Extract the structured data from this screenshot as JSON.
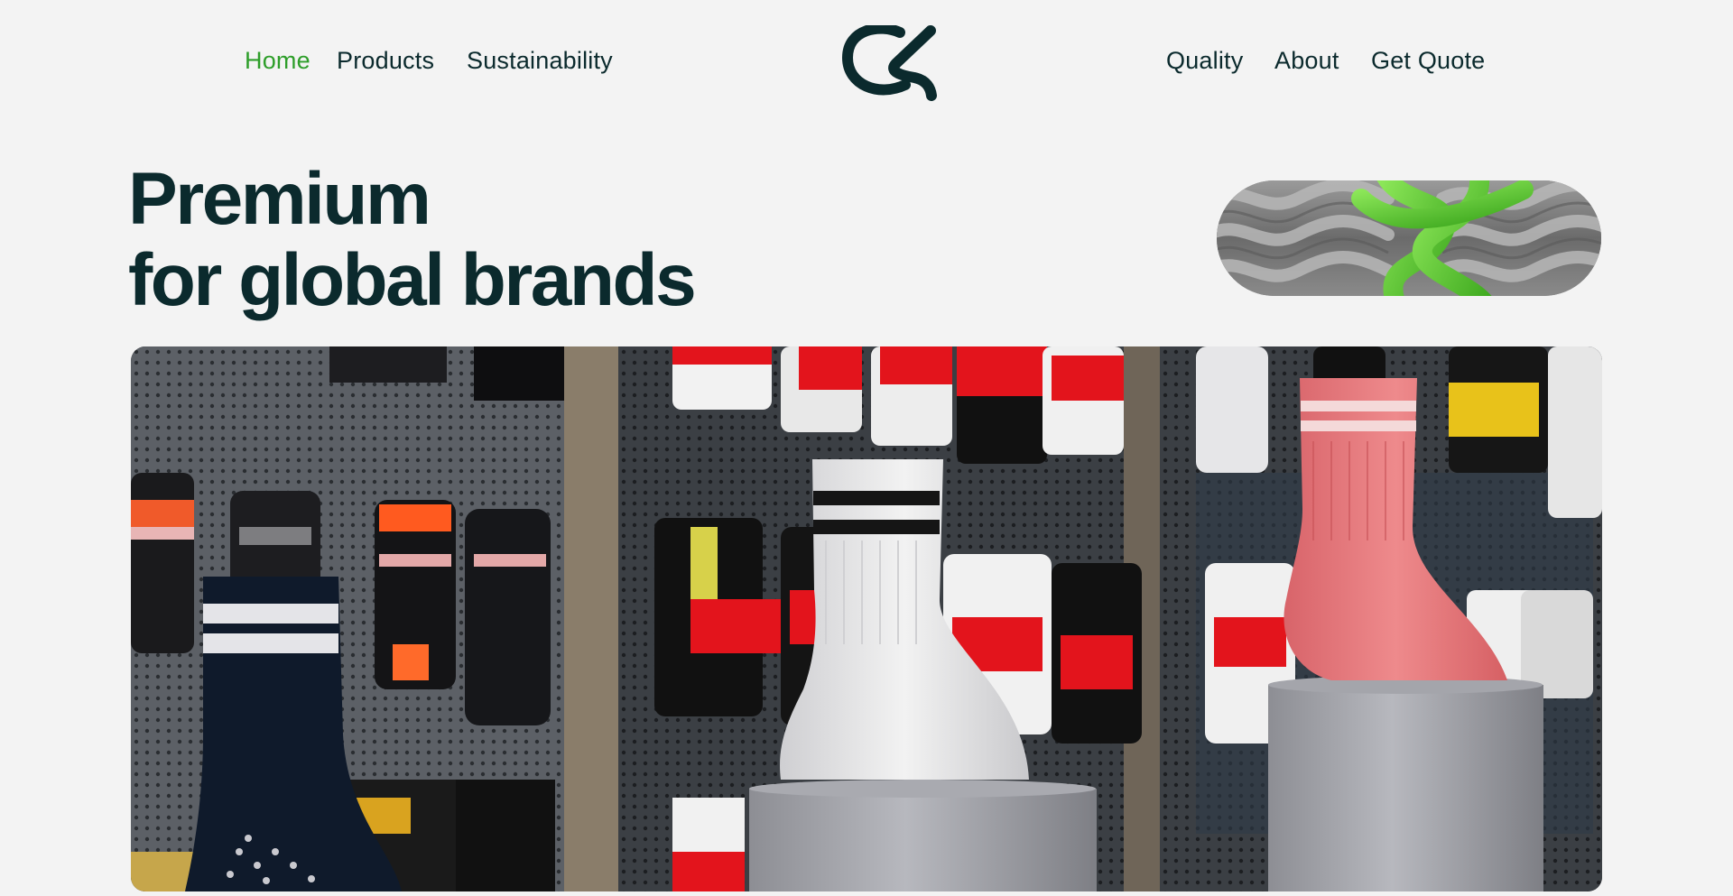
{
  "nav": {
    "left": [
      {
        "label": "Home",
        "active": true
      },
      {
        "label": "Products",
        "active": false
      },
      {
        "label": "Sustainability",
        "active": false
      }
    ],
    "right": [
      {
        "label": "Quality",
        "active": false
      },
      {
        "label": "About",
        "active": false
      },
      {
        "label": "Get Quote",
        "active": false
      }
    ],
    "logo_icon": "ck-monogram-logo"
  },
  "hero": {
    "title_line1": "Premium",
    "title_line2": "for global brands",
    "texture_image_icon": "braided-yarn-image",
    "main_image_icon": "sock-display-photo"
  },
  "colors": {
    "background": "#f3f3f3",
    "text_dark": "#0b2a2d",
    "accent_green": "#2e9e2a",
    "yarn_green": "#6fd33a",
    "sock_pink": "#e7797b",
    "tag_red": "#e3141c"
  }
}
